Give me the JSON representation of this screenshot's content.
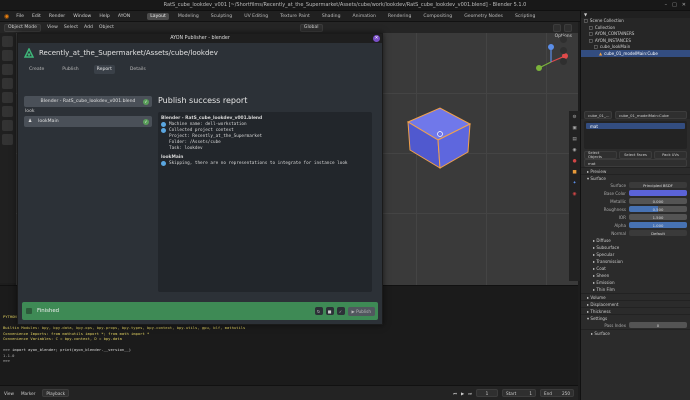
{
  "window": {
    "title": "RatS_cube_lookdev_v001 [~/Shortfilms/Recently_at_the_Supermarket/Assets/cube/work/lookdev/RatS_cube_lookdev_v001.blend] - Blender 5.1.0"
  },
  "menu": [
    "File",
    "Edit",
    "Render",
    "Window",
    "Help",
    "AYON"
  ],
  "workspaces": [
    {
      "label": "Layout",
      "active": true
    },
    {
      "label": "Modeling"
    },
    {
      "label": "Sculpting"
    },
    {
      "label": "UV Editing"
    },
    {
      "label": "Texture Paint"
    },
    {
      "label": "Shading"
    },
    {
      "label": "Animation"
    },
    {
      "label": "Rendering"
    },
    {
      "label": "Compositing"
    },
    {
      "label": "Geometry Nodes"
    },
    {
      "label": "Scripting"
    }
  ],
  "scene": {
    "label": "Scene",
    "view_layer": "ViewLayer"
  },
  "viewport": {
    "mode": "Object Mode",
    "menus": [
      "View",
      "Select",
      "Add",
      "Object"
    ],
    "orientation": "Global",
    "options": "Options"
  },
  "outliner": {
    "rows": [
      {
        "label": "Scene Collection",
        "level": 0
      },
      {
        "label": "Collection",
        "level": 1
      },
      {
        "label": "AYON_CONTAINERS",
        "level": 1
      },
      {
        "label": "AYON_INSTANCES",
        "level": 1
      },
      {
        "label": "cube_lookMain",
        "level": 2
      },
      {
        "label": "cube_01_modelMain:Cube",
        "level": 3,
        "selected": true
      }
    ]
  },
  "properties": {
    "object": "cube_01_...",
    "material_slot": "cube_01_modelMain:Cube",
    "material_name": "mat",
    "slot_buttons": [
      "Select Objects",
      "Select Faces",
      "Pack UVs"
    ],
    "sections": [
      "Preview",
      "Surface"
    ],
    "surface_shader": "Principled BSDF",
    "fields": [
      {
        "label": "Base Color",
        "value": "",
        "color": "#5b63d8"
      },
      {
        "label": "Metallic",
        "value": "0.000"
      },
      {
        "label": "Roughness",
        "value": "0.500"
      },
      {
        "label": "IOR",
        "value": "1.500"
      },
      {
        "label": "Alpha",
        "value": "1.000"
      }
    ],
    "normal": {
      "label": "Normal",
      "value": "Default"
    },
    "subsections": [
      "Diffuse",
      "Subsurface",
      "Specular",
      "Transmission",
      "Coat",
      "Sheen",
      "Emission",
      "Thin Film"
    ],
    "bottom_sections": [
      "Volume",
      "Displacement",
      "Thickness",
      "Settings"
    ],
    "pass_index": {
      "label": "Pass Index",
      "value": "0"
    },
    "surface2": "Surface"
  },
  "publisher": {
    "title": "AYON Publisher - blender",
    "project_path": "Recently_at_the_Supermarket/Assets/cube/lookdev",
    "tabs": [
      {
        "label": "Create"
      },
      {
        "label": "Publish"
      },
      {
        "label": "Report",
        "active": true
      },
      {
        "label": "Details"
      }
    ],
    "instances": [
      {
        "label": "Blender - RatS_cube_lookdev_v001.blend",
        "type": "file"
      },
      {
        "group": "look"
      },
      {
        "label": "lookMain",
        "type": "look"
      }
    ],
    "report_title": "Publish success report",
    "report": {
      "header1": "Blender - RatS_cube_lookdev_v001.blend",
      "lines1": [
        {
          "text": "Machine name: dell-workstation",
          "dot": true
        },
        {
          "text": "Collected project context",
          "dot": true
        },
        {
          "text": "Project: Recently_at_the_Supermarket",
          "dot": false
        },
        {
          "text": "Folder: /Assets/cube",
          "dot": false
        },
        {
          "text": "Task: lookdev",
          "dot": false
        }
      ],
      "header2": "lookMain",
      "lines2": [
        {
          "text": "Skipping, there are no representations to integrate for instance look",
          "dot": true
        }
      ]
    },
    "status": "Finished",
    "publish_button": "Publish"
  },
  "console": {
    "lines": [
      "PYTHON INTERACTIVE CONSOLE 3.13.9 (main, Apr 15 2025, 12:39:28) [GCC 14.2.1 20250110 (Red Hat 14.2.1-7)]",
      "",
      "Builtin Modules:       bpy, bpy.data, bpy.ops, bpy.props, bpy.types, bpy.context, bpy.utils, gpu, blf, mathutils",
      "Convenience Imports:   from mathutils import *; from math import *",
      "Convenience Variables: C = bpy.context, D = bpy.data",
      "",
      ">>> import ayon_blender; print(ayon_blender.__version__)",
      "1.1.0",
      ">>> "
    ]
  },
  "timeline": {
    "menus": [
      "View",
      "Marker",
      "Playback"
    ],
    "frame": "1",
    "start_label": "Start",
    "start": "1",
    "end_label": "End",
    "end": "250"
  }
}
